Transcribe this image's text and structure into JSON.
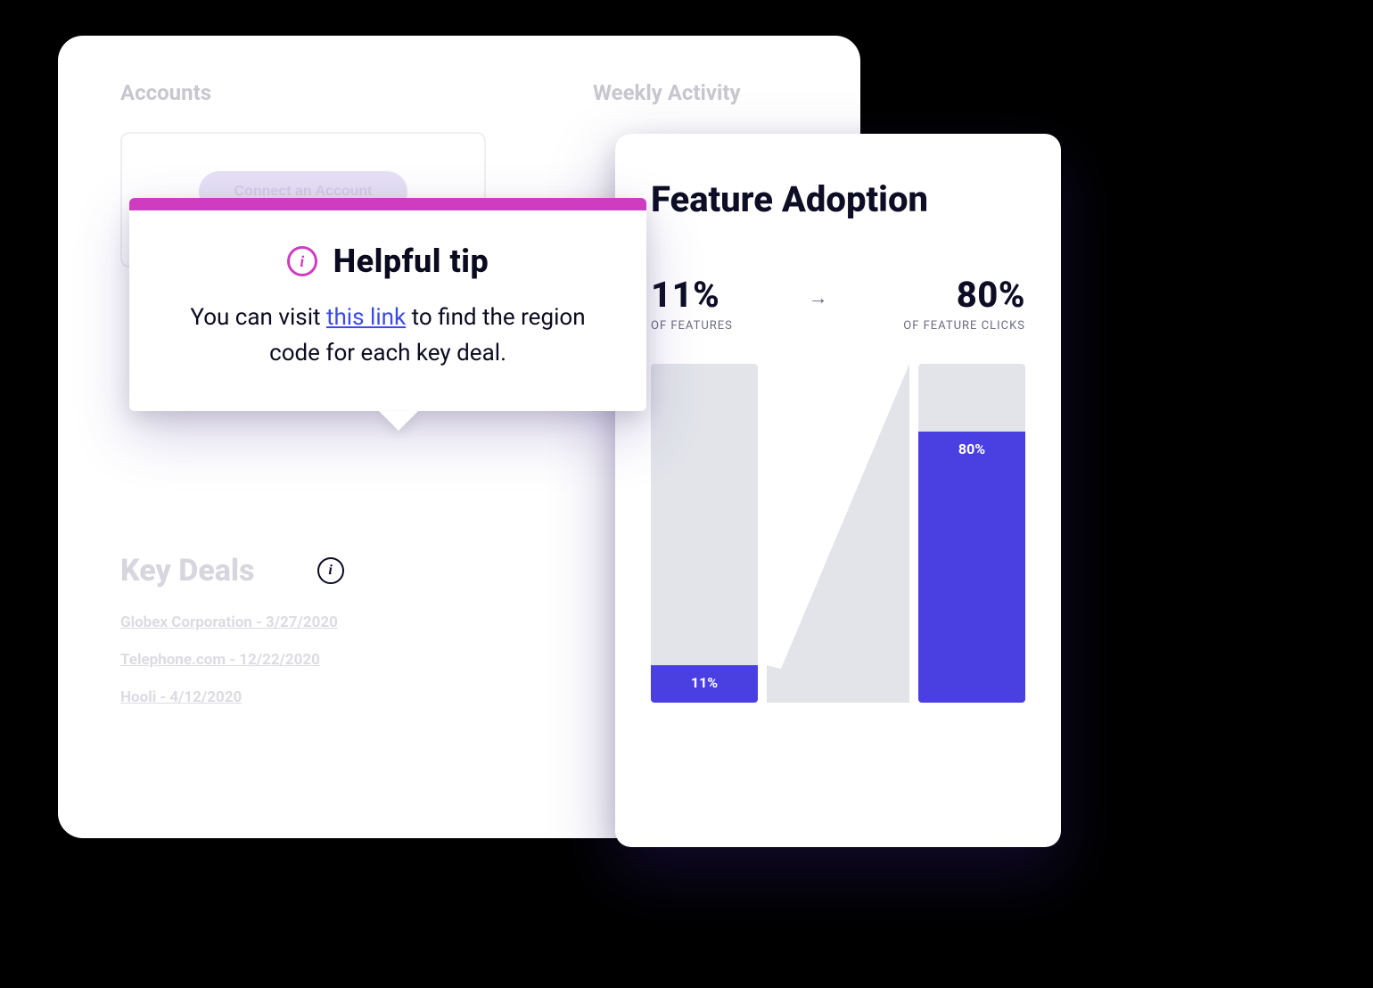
{
  "cardA": {
    "accounts_heading": "Accounts",
    "weekly_heading": "Weekly Activity",
    "connect_label": "Connect an Account",
    "key_deals_heading": "Key Deals",
    "deals": [
      "Globex Corporation - 3/27/2020",
      "Telephone.com - 12/22/2020",
      "Hooli - 4/12/2020"
    ]
  },
  "tooltip": {
    "title": "Helpful tip",
    "body_pre": "You can visit ",
    "link_text": "this link",
    "body_post": " to find the region code for each key deal."
  },
  "feature": {
    "title": "Feature Adoption",
    "left_pct": "11%",
    "left_lbl": "OF FEATURES",
    "right_pct": "80%",
    "right_lbl": "OF FEATURE CLICKS",
    "bar_left_label": "11%",
    "bar_right_label": "80%"
  },
  "chart_data": {
    "type": "bar",
    "title": "Feature Adoption",
    "categories": [
      "OF FEATURES",
      "OF FEATURE CLICKS"
    ],
    "values": [
      11,
      80
    ],
    "ylim": [
      0,
      100
    ],
    "xlabel": "",
    "ylabel": ""
  }
}
